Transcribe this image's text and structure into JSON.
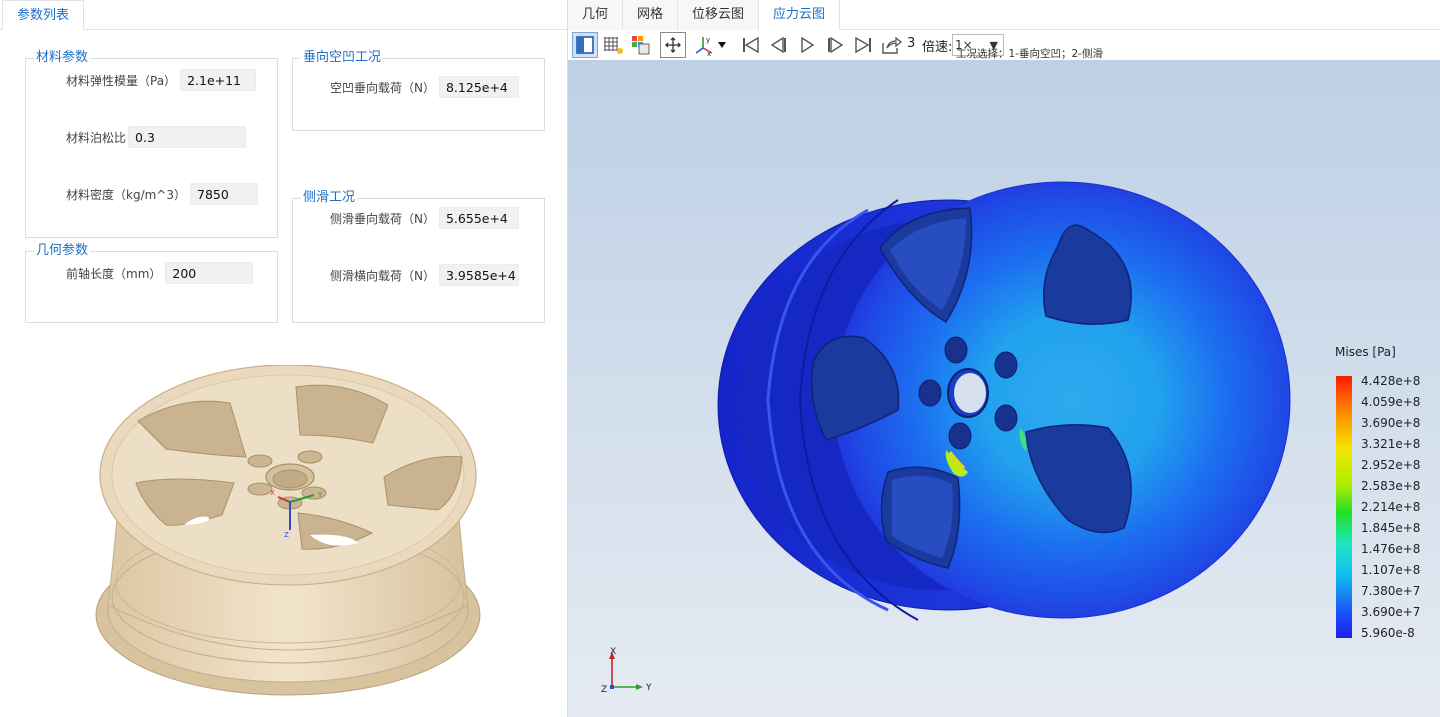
{
  "left_panel": {
    "tab": "参数列表",
    "material": {
      "title": "材料参数",
      "youngs_label": "材料弹性模量（Pa）",
      "youngs_value": "2.1e+11",
      "poisson_label": "材料泊松比",
      "poisson_value": "0.3",
      "density_label": "材料密度（kg/m^3）",
      "density_value": "7850"
    },
    "geometry": {
      "title": "几何参数",
      "axle_label": "前轴长度（mm）",
      "axle_value": "200"
    },
    "vertical": {
      "title": "垂向空凹工况",
      "load_label": "空凹垂向载荷（N）",
      "load_value": "8.125e+4"
    },
    "side": {
      "title": "侧滑工况",
      "vert_label": "侧滑垂向载荷（N）",
      "vert_value": "5.655e+4",
      "lat_label": "侧滑横向载荷（N）",
      "lat_value": "3.9585e+4"
    },
    "wheel_triad": {
      "x": "X",
      "y": "Y",
      "z": "Z"
    }
  },
  "right_panel": {
    "tabs": [
      {
        "label": "几何",
        "active": false
      },
      {
        "label": "网格",
        "active": false
      },
      {
        "label": "位移云图",
        "active": false
      },
      {
        "label": "应力云图",
        "active": true
      }
    ],
    "toolbar": {
      "step_number": "3",
      "speed_label": "倍速:",
      "speed_value": "1×",
      "hint": "工况选择：1-垂向空凹；2-侧滑"
    },
    "legend": {
      "title": "Mises [Pa]",
      "labels": [
        "4.428e+8",
        "4.059e+8",
        "3.690e+8",
        "3.321e+8",
        "2.952e+8",
        "2.583e+8",
        "2.214e+8",
        "1.845e+8",
        "1.476e+8",
        "1.107e+8",
        "7.380e+7",
        "3.690e+7",
        "5.960e-8"
      ]
    },
    "triad": {
      "x": "X",
      "y": "Y",
      "z": "Z"
    }
  },
  "colors": {
    "accent": "#1e6fc6",
    "wheel_beige": "#e8d6b8",
    "stress_blue": "#1f3fe0",
    "stress_cyan": "#1fb7f0"
  }
}
